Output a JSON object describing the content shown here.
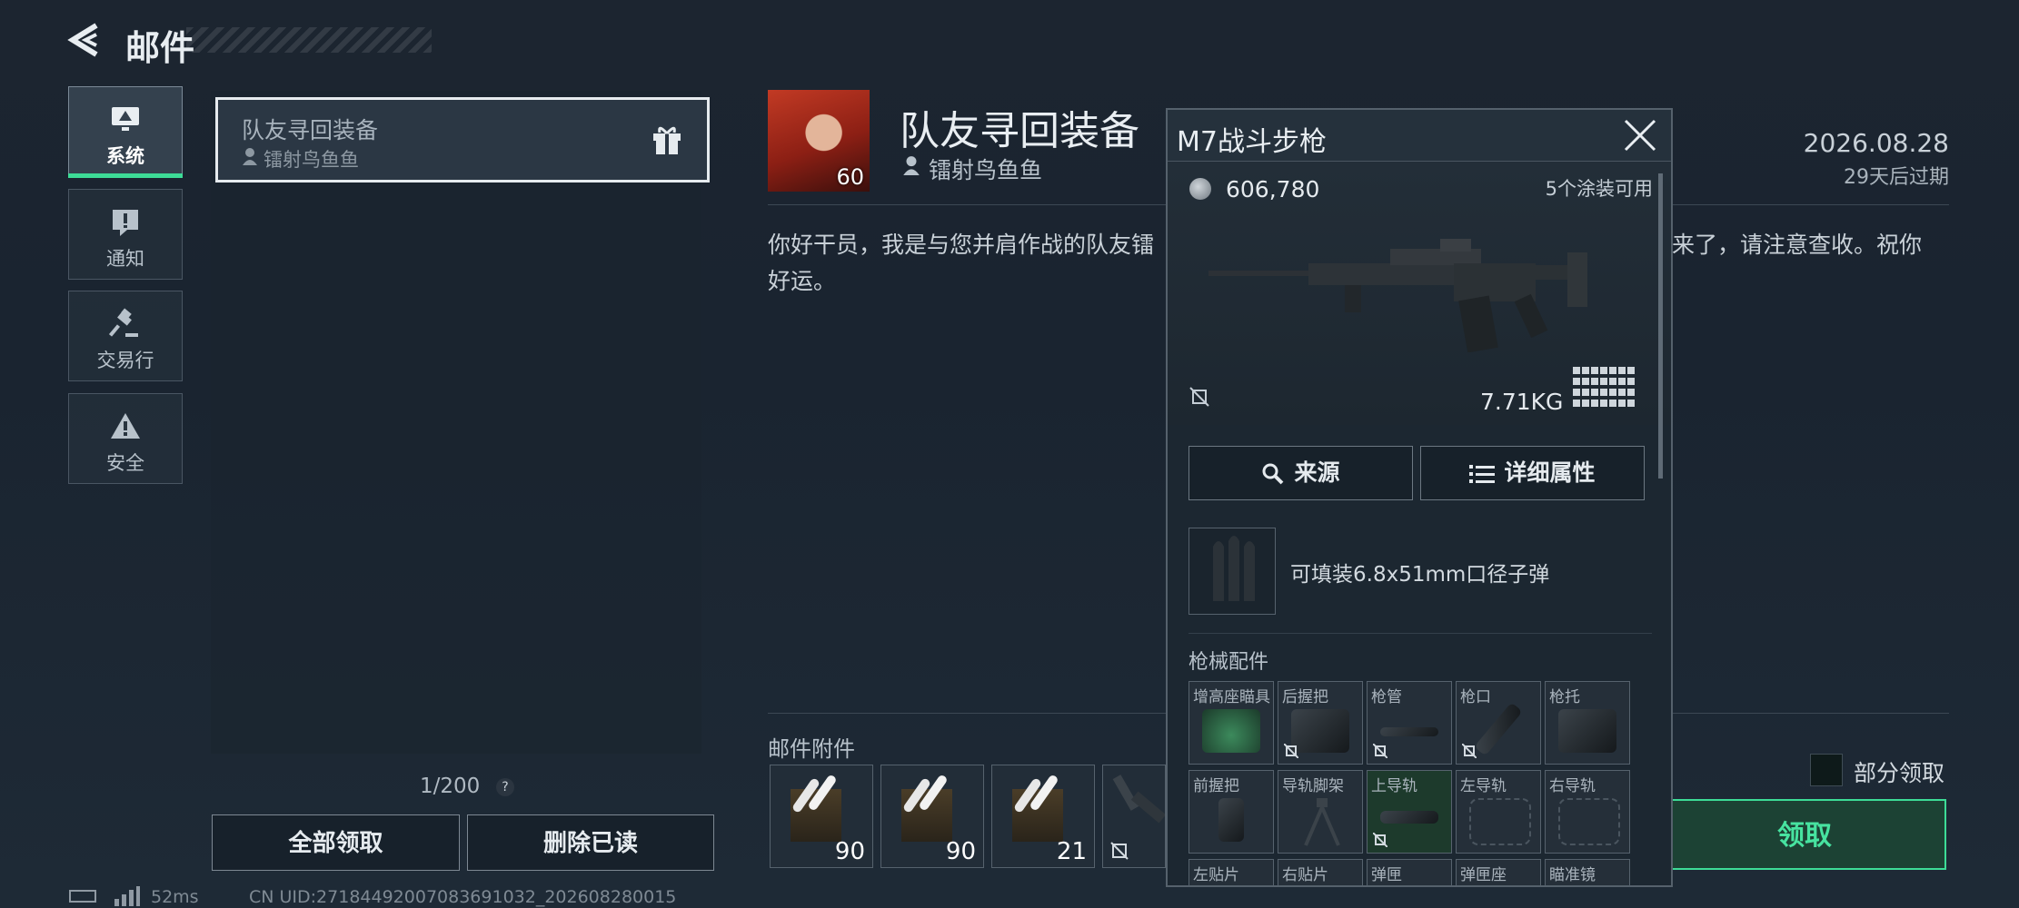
{
  "header": {
    "title": "邮件",
    "back_icon": "chevron-left-icon"
  },
  "sidebar": {
    "items": [
      {
        "label": "系统",
        "icon": "monitor-icon",
        "active": true
      },
      {
        "label": "通知",
        "icon": "alert-bubble-icon"
      },
      {
        "label": "交易行",
        "icon": "gavel-icon"
      },
      {
        "label": "安全",
        "icon": "warning-triangle-icon"
      }
    ]
  },
  "mail_list": {
    "items": [
      {
        "title": "队友寻回装备",
        "sender": "镭射鸟鱼鱼"
      }
    ],
    "count": "1/200",
    "help": "?",
    "claim_all": "全部领取",
    "delete_read": "删除已读"
  },
  "status": {
    "ping": "52ms",
    "uid": "CN UID:27184492007083691032_202608280015"
  },
  "mail": {
    "title": "队友寻回装备",
    "sender": "镭射鸟鱼鱼",
    "avatar_level": "60",
    "date": "2026.08.28",
    "expire": "29天后过期",
    "body_left": "你好干员，我是与您并肩作战的队友镭",
    "body_right": "来了，请注意查收。祝你",
    "body_line2": "好运。",
    "attachments_label": "邮件附件",
    "attachments": [
      {
        "qty": "90"
      },
      {
        "qty": "90"
      },
      {
        "qty": "21"
      }
    ],
    "partial_claim": "部分领取",
    "claim": "领取"
  },
  "popup": {
    "title": "M7战斗步枪",
    "price": "606,780",
    "skins": "5个涂装可用",
    "weight": "7.71KG",
    "source_btn": "来源",
    "attr_btn": "详细属性",
    "ammo_text": "可填装6.8x51mm口径子弹",
    "accessories_label": "枪械配件",
    "slots": [
      {
        "label": "增高座瞄具"
      },
      {
        "label": "后握把"
      },
      {
        "label": "枪管"
      },
      {
        "label": "枪口"
      },
      {
        "label": "枪托"
      },
      {
        "label": "前握把"
      },
      {
        "label": "导轨脚架"
      },
      {
        "label": "上导轨"
      },
      {
        "label": "左导轨"
      },
      {
        "label": "右导轨"
      },
      {
        "label": "左贴片"
      },
      {
        "label": "右贴片"
      },
      {
        "label": "弹匣"
      },
      {
        "label": "弹匣座"
      },
      {
        "label": "瞄准镜"
      }
    ]
  },
  "colors": {
    "accent": "#3ddc97",
    "background": "#1c2530"
  }
}
